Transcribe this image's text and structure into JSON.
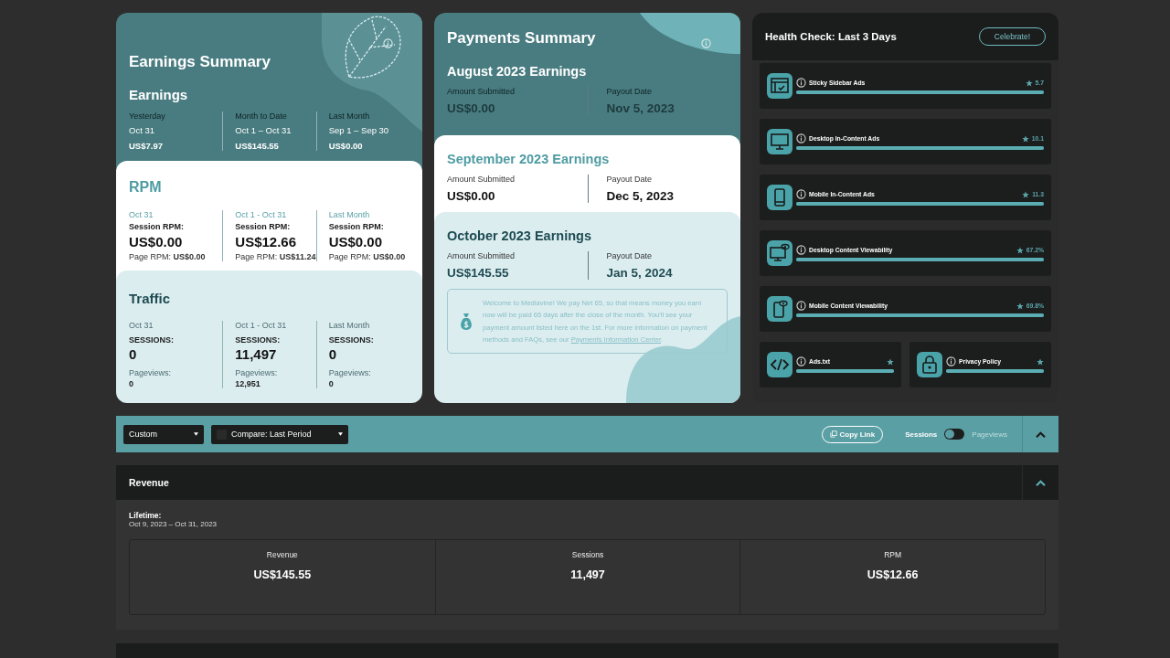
{
  "earnings_summary": {
    "title": "Earnings Summary",
    "subtitle": "Earnings",
    "columns": [
      {
        "label": "Yesterday",
        "range": "Oct 31",
        "value": "US$7.97"
      },
      {
        "label": "Month to Date",
        "range": "Oct 1 – Oct 31",
        "value": "US$145.55"
      },
      {
        "label": "Last Month",
        "range": "Sep 1 – Sep 30",
        "value": "US$0.00"
      }
    ]
  },
  "rpm": {
    "title": "RPM",
    "columns": [
      {
        "period": "Oct 31",
        "metric_label": "Session RPM:",
        "value": "US$0.00",
        "page_rpm": "Page RPM: **US$0.00**"
      },
      {
        "period": "Oct 1 - Oct 31",
        "metric_label": "Session RPM:",
        "value": "US$12.66",
        "page_rpm": "Page RPM: **US$11.24**"
      },
      {
        "period": "Last Month",
        "metric_label": "Session RPM:",
        "value": "US$0.00",
        "page_rpm": "Page RPM: **US$0.00**"
      }
    ]
  },
  "traffic": {
    "title": "Traffic",
    "columns": [
      {
        "period": "Oct 31",
        "metric_label": "SESSIONS:",
        "value": "0",
        "sub_label": "Pageviews:",
        "sub_value": "0"
      },
      {
        "period": "Oct 1 - Oct 31",
        "metric_label": "SESSIONS:",
        "value": "11,497",
        "sub_label": "Pageviews:",
        "sub_value": "12,951"
      },
      {
        "period": "Last Month",
        "metric_label": "SESSIONS:",
        "value": "0",
        "sub_label": "Pageviews:",
        "sub_value": "0"
      }
    ]
  },
  "payments_summary": {
    "title": "Payments Summary",
    "months": [
      {
        "kind": "teal",
        "title": "August 2023 Earnings",
        "amount_label": "Amount Submitted",
        "amount": "US$0.00",
        "date_label": "Payout Date",
        "date": "Nov 5, 2023"
      },
      {
        "kind": "white",
        "title": "September 2023 Earnings",
        "amount_label": "Amount Submitted",
        "amount": "US$0.00",
        "date_label": "Payout Date",
        "date": "Dec 5, 2023"
      },
      {
        "kind": "light",
        "title": "October 2023 Earnings",
        "amount_label": "Amount Submitted",
        "amount": "US$145.55",
        "date_label": "Payout Date",
        "date": "Jan 5, 2024"
      }
    ],
    "notice": {
      "text": "Welcome to Mediavine! We pay Net 65, so that means money you earn now will be paid 65 days after the close of the month. You'll see your payment amount listed here on the 1st. For more information on payment methods and FAQs, see our ",
      "link": "Payments Information Center",
      "end": "."
    }
  },
  "health_check": {
    "title": "Health Check: Last 3 Days",
    "button": "Celebrate!",
    "items": [
      {
        "kind": "sidebar",
        "name": "Sticky Sidebar Ads",
        "score": "5.7",
        "level": 1
      },
      {
        "kind": "desktop",
        "name": "Desktop In-Content Ads",
        "score": "10.1",
        "level": 1
      },
      {
        "kind": "mobile",
        "name": "Mobile In-Content Ads",
        "score": "11.3",
        "level": 1
      },
      {
        "kind": "desktop-view",
        "name": "Desktop Content Viewability",
        "score": "67.2%",
        "level": 1
      },
      {
        "kind": "mobile-view",
        "name": "Mobile Content Viewability",
        "score": "69.8%",
        "level": 1
      }
    ],
    "small_items": [
      {
        "kind": "code",
        "name": "Ads.txt",
        "level": 1
      },
      {
        "kind": "lock",
        "name": "Privacy Policy",
        "level": 1
      }
    ]
  },
  "toolbar": {
    "range": "Custom",
    "compare": {
      "label": "Compare: Last Period",
      "checked": false
    },
    "copy_link": "Copy Link",
    "toggle": [
      {
        "label": "Sessions",
        "selected": true
      },
      {
        "label": "Pageviews",
        "selected": false
      }
    ]
  },
  "revenue": {
    "title": "Revenue",
    "lifetime_label": "Lifetime:",
    "lifetime_range": "Oct 9, 2023 – Oct 31, 2023",
    "stats": [
      {
        "label": "Revenue",
        "value": "US$145.55"
      },
      {
        "label": "Sessions",
        "value": "11,497"
      },
      {
        "label": "RPM",
        "value": "US$12.66"
      }
    ]
  }
}
